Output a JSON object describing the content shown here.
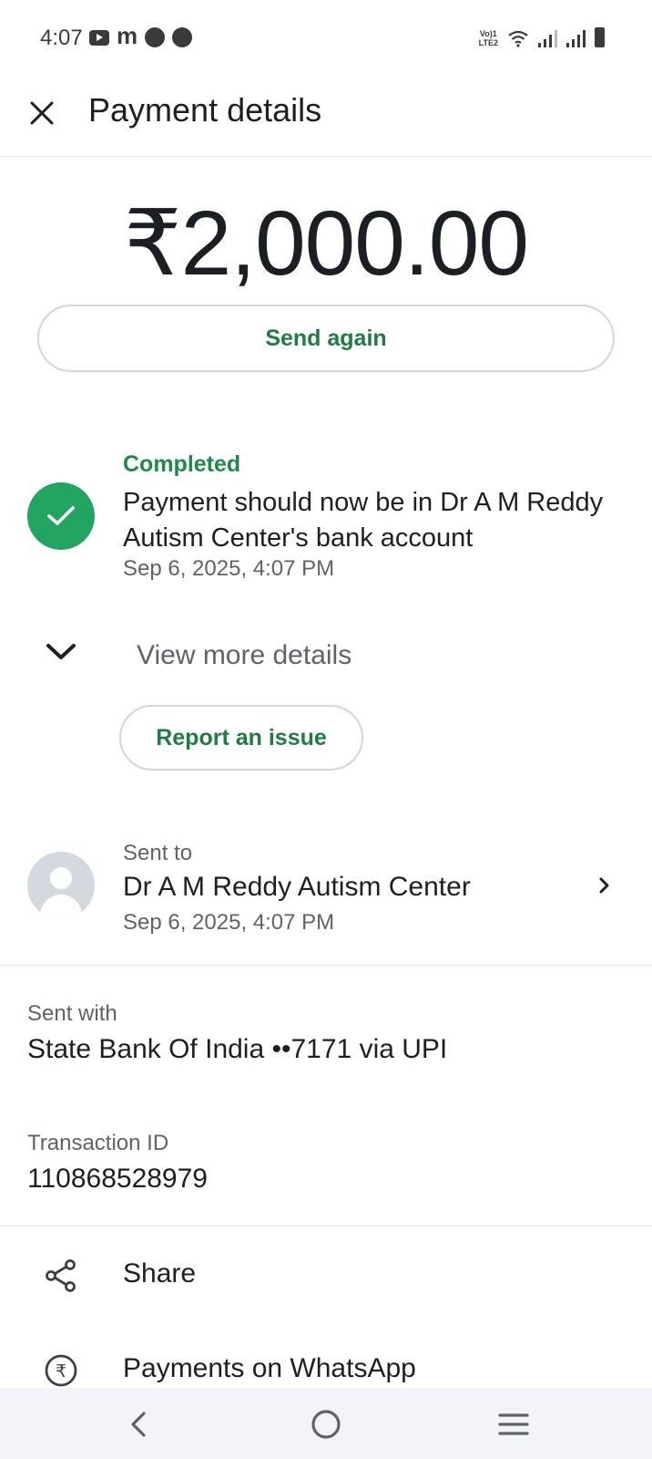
{
  "status_bar": {
    "time": "4:07",
    "network_label": "Vo)) LTE2"
  },
  "header": {
    "title": "Payment details"
  },
  "payment": {
    "amount": "₹2,000.00",
    "send_again_label": "Send again"
  },
  "status": {
    "label": "Completed",
    "message": "Payment should now be in Dr A M Reddy Autism Center's bank account",
    "timestamp": "Sep 6, 2025, 4:07 PM",
    "accent_color": "#22a560"
  },
  "details": {
    "view_more_label": "View more details",
    "report_issue_label": "Report an issue"
  },
  "recipient": {
    "label": "Sent to",
    "name": "Dr A M Reddy Autism Center",
    "timestamp": "Sep 6, 2025, 4:07 PM"
  },
  "sent_with": {
    "label": "Sent with",
    "value": "State Bank Of India ••7171 via UPI"
  },
  "transaction": {
    "label": "Transaction ID",
    "value": "110868528979"
  },
  "actions": [
    {
      "label": "Share",
      "icon": "share-icon"
    },
    {
      "label": "Payments on WhatsApp",
      "icon": "rupee-circle-icon"
    }
  ],
  "nav": {
    "back": "back-icon",
    "home": "home-icon",
    "menu": "menu-icon"
  }
}
